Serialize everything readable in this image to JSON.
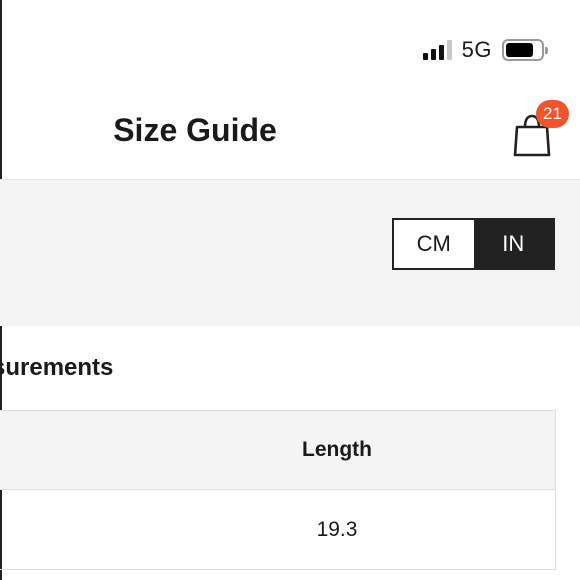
{
  "status_bar": {
    "network": "5G",
    "signal_bars_active": 3,
    "battery_level": 0.8
  },
  "header": {
    "title": "Size Guide",
    "cart_icon": "shopping-bag-icon",
    "cart_badge_count": "21",
    "badge_color": "#f4532b"
  },
  "unit_toggle": {
    "options": [
      {
        "label": "CM",
        "active": false
      },
      {
        "label": "IN",
        "active": true
      }
    ]
  },
  "measurements": {
    "title": "Measurements",
    "title_visible": "surements",
    "columns": [
      "",
      "Length"
    ],
    "rows": [
      [
        "",
        "19.3"
      ]
    ]
  },
  "colors": {
    "accent_dark": "#222222",
    "band_background": "#f4f4f4",
    "badge": "#f4532b"
  }
}
